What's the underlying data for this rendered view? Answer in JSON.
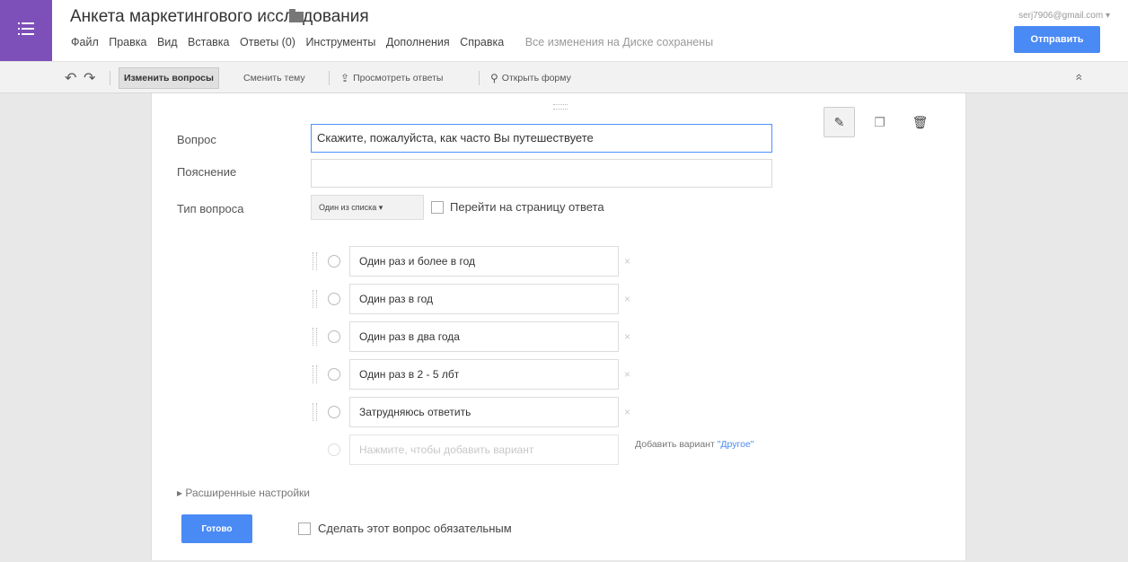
{
  "header": {
    "title": "Анкета маркетингового исследования",
    "account": "serj7906@gmail.com ▾",
    "send_label": "Отправить",
    "menu": [
      "Файл",
      "Правка",
      "Вид",
      "Вставка",
      "Ответы (0)",
      "Инструменты",
      "Дополнения",
      "Справка"
    ],
    "saved_status": "Все изменения на Диске сохранены",
    "icons": {
      "apps": "apps-icon",
      "star": "star-icon",
      "folder": "folder-icon"
    }
  },
  "toolbar": {
    "edit_questions": "Изменить вопросы",
    "change_theme": "Сменить тему",
    "view_responses": "Просмотреть ответы",
    "open_form": "Открыть форму",
    "undo_icon": "↶",
    "redo_icon": "↷",
    "collapse_icon": "»"
  },
  "question": {
    "label_question": "Вопрос",
    "question_value": "Скажите, пожалуйста, как часто Вы путешествуете",
    "label_help": "Пояснение",
    "help_value": "",
    "label_type": "Тип вопроса",
    "type_value": "Один из списка ▾",
    "goto_page_label": "Перейти на страницу ответа",
    "options": [
      {
        "text": "Один раз и более в год"
      },
      {
        "text": "Один раз в год"
      },
      {
        "text": "Один раз в два года"
      },
      {
        "text": "Один раз в 2 - 5 лбт"
      },
      {
        "text": "Затрудняюсь ответить"
      }
    ],
    "add_option_placeholder": "Нажмите, чтобы добавить вариант",
    "add_other_prefix": "Добавить вариант",
    "add_other_link": "\"Другое\"",
    "option_remove_glyph": "×",
    "advanced_settings": "▸ Расширенные настройки",
    "done_label": "Готово",
    "required_label": "Сделать этот вопрос обязательным"
  },
  "colors": {
    "accent": "#4a8af4",
    "app_tile": "#7d4fb8"
  }
}
